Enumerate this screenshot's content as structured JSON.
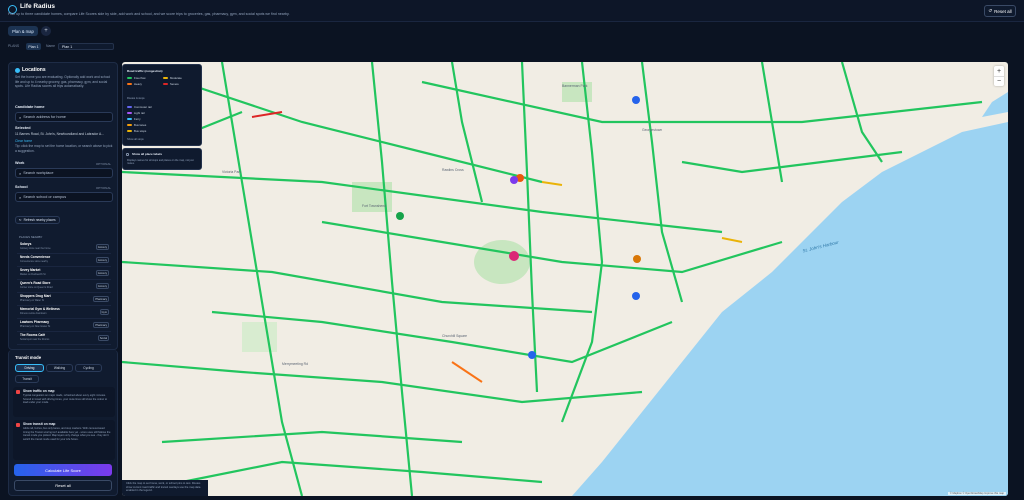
{
  "app": {
    "title": "Life Radius",
    "subtitle": "Plan up to three candidate homes, compare Life Scores side by side, add work and school, and we score trips to groceries, gas, pharmacy, gym, and social spots we find nearby.",
    "reset_all": "Reset all"
  },
  "tabs": {
    "active": "Plan & map",
    "add": "+"
  },
  "planbar": {
    "plans_label": "PLANS",
    "plan_chip": "Plan 1",
    "name_label": "Name",
    "name_value": "Plan 1"
  },
  "locations": {
    "title": "Locations",
    "intro": "Set the home you are evaluating. Optionally add work and school life and up to 4 nearby grocery, gas, pharmacy, gym, and social spots. Life Radius scores all trips automatically.",
    "candidate_label": "Candidate home",
    "candidate_placeholder": "Search address for home",
    "selected_label": "Selected",
    "selected_value": "11 Barnes Road, St. John's, Newfoundland and Labrador A...",
    "clear_label": "Clear home",
    "click_hint": "Tip: click the map to set the home location, or search above to pick a suggestion.",
    "work_label": "Work",
    "work_optional": "OPTIONAL",
    "work_placeholder": "Search workplace",
    "school_label": "School",
    "school_optional": "OPTIONAL",
    "school_placeholder": "Search school or campus",
    "refresh_label": "Refresh nearby places",
    "places_header": "PLACES NEARBY",
    "places": [
      {
        "name": "Sobeys",
        "sub": "Grocery store near the home",
        "tag": "Grocery"
      },
      {
        "name": "Needs Convenience",
        "sub": "Convenience store nearby",
        "tag": "Grocery"
      },
      {
        "name": "Sevey Market",
        "sub": "Market on Duckworth St",
        "tag": "Grocery"
      },
      {
        "name": "Queen's Road Store",
        "sub": "Corner store on Queen's Road",
        "tag": "Grocery"
      },
      {
        "name": "Shoppers Drug Mart",
        "sub": "Pharmacy on Water St",
        "tag": "Pharmacy"
      },
      {
        "name": "Memorial Gym & Wellness",
        "sub": "Fitness centre downtown",
        "tag": "Gym"
      },
      {
        "name": "Lawtons Pharmacy",
        "sub": "Pharmacy on New Gower St",
        "tag": "Pharmacy"
      },
      {
        "name": "The Rooms Café",
        "sub": "Social spot near the Rooms",
        "tag": "Social"
      }
    ]
  },
  "transit": {
    "title": "Transit mode",
    "modes": [
      "Driving",
      "Walking",
      "Cycling",
      "Transit"
    ],
    "traffic_title": "Show traffic on map",
    "traffic_desc": "Typical congestion on major roads, refreshed about every eight minutes. Scored in travel with driving times, your route lines still show the colour to load under your mode.",
    "transit_title": "Show transit on map",
    "transit_desc": "Adds rail, ferries, bus only lanes, and stop markers. With census-based timing the Transit scoring isn't available here yet - score uses still follows the transit mode you picked. Map layers only change what you see - they don't switch the transit mode used for your Life Score."
  },
  "actions": {
    "calculate": "Calculate Life Score",
    "reset": "Reset all"
  },
  "map": {
    "legend_title": "Road traffic (congestion)",
    "legend": [
      {
        "label": "Free flow",
        "color": "#22c55e"
      },
      {
        "label": "Moderate",
        "color": "#eab308"
      },
      {
        "label": "Heavy",
        "color": "#f97316"
      },
      {
        "label": "Severe",
        "color": "#dc2626"
      }
    ],
    "legend_section2": "Routes & stops",
    "legend_items2": [
      "Commuter rail",
      "Light rail",
      "Ferry",
      "Bus lanes",
      "Bus stops"
    ],
    "legend_note": "Show all stops",
    "show_place_labels": "Show all place labels",
    "show_place_desc": "Displays names for all stops and places on the map, not just routes.",
    "footer": "Click the map to set home, work, or school pins to test. Routes show current road traffic and transit overlays use the map data enabled in the legend.",
    "attribution": "© Mapbox © OpenStreetMap Improve this map",
    "water_label": "St. John's Harbour",
    "labels": [
      "Bannerman Park",
      "Fort Townshend",
      "Rawlins Cross",
      "Victoria Park",
      "Churchill Square",
      "Georgestown",
      "Merrymeeting Rd"
    ],
    "colors": {
      "water": "#9cd3f2",
      "land": "#f1ede4",
      "road": "#22c55e",
      "park": "#c8e6c0"
    }
  }
}
